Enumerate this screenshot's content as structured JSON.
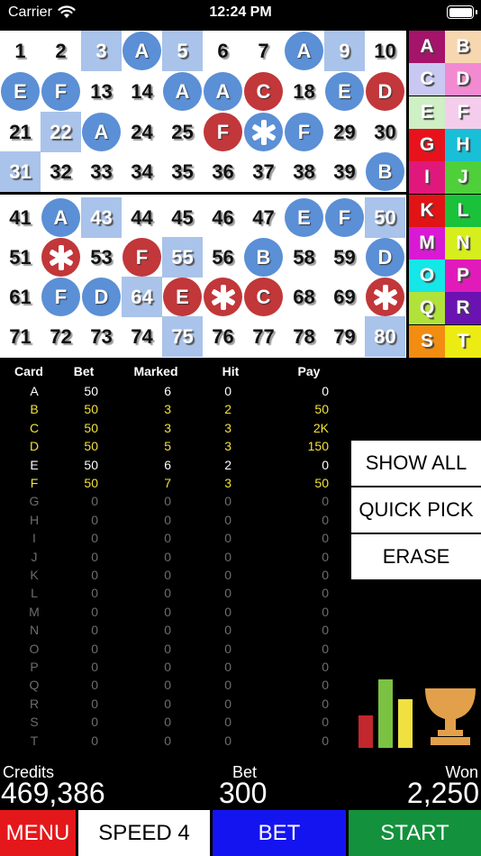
{
  "status_bar": {
    "carrier": "Carrier",
    "time": "12:24 PM"
  },
  "board": {
    "rows": [
      [
        {
          "n": "1"
        },
        {
          "n": "2"
        },
        {
          "n": "3",
          "sel": true
        },
        {
          "n": "4",
          "mark": "A",
          "color": "blue"
        },
        {
          "n": "5",
          "sel": true
        },
        {
          "n": "6"
        },
        {
          "n": "7"
        },
        {
          "n": "8",
          "mark": "A",
          "color": "blue"
        },
        {
          "n": "9",
          "sel": true
        },
        {
          "n": "10"
        }
      ],
      [
        {
          "n": "11",
          "mark": "E",
          "color": "blue"
        },
        {
          "n": "12",
          "mark": "F",
          "color": "blue"
        },
        {
          "n": "13"
        },
        {
          "n": "14"
        },
        {
          "n": "15",
          "mark": "A",
          "color": "blue"
        },
        {
          "n": "16",
          "mark": "A",
          "color": "blue"
        },
        {
          "n": "17",
          "mark": "C",
          "color": "red"
        },
        {
          "n": "18"
        },
        {
          "n": "19",
          "mark": "E",
          "color": "blue"
        },
        {
          "n": "20",
          "mark": "D",
          "color": "red"
        }
      ],
      [
        {
          "n": "21"
        },
        {
          "n": "22",
          "sel": true
        },
        {
          "n": "23",
          "mark": "A",
          "color": "blue"
        },
        {
          "n": "24"
        },
        {
          "n": "25"
        },
        {
          "n": "26",
          "mark": "F",
          "color": "red"
        },
        {
          "n": "27",
          "mark": "*",
          "color": "blue"
        },
        {
          "n": "28",
          "mark": "F",
          "color": "blue"
        },
        {
          "n": "29"
        },
        {
          "n": "30"
        }
      ],
      [
        {
          "n": "31",
          "sel": true
        },
        {
          "n": "32"
        },
        {
          "n": "33"
        },
        {
          "n": "34"
        },
        {
          "n": "35"
        },
        {
          "n": "36"
        },
        {
          "n": "37"
        },
        {
          "n": "38"
        },
        {
          "n": "39"
        },
        {
          "n": "40",
          "mark": "B",
          "color": "blue"
        }
      ],
      [
        {
          "n": "41"
        },
        {
          "n": "42",
          "mark": "A",
          "color": "blue"
        },
        {
          "n": "43",
          "sel": true
        },
        {
          "n": "44"
        },
        {
          "n": "45"
        },
        {
          "n": "46"
        },
        {
          "n": "47"
        },
        {
          "n": "48",
          "mark": "E",
          "color": "blue"
        },
        {
          "n": "49",
          "mark": "F",
          "color": "blue"
        },
        {
          "n": "50",
          "sel": true
        }
      ],
      [
        {
          "n": "51"
        },
        {
          "n": "52",
          "mark": "*",
          "color": "red"
        },
        {
          "n": "53"
        },
        {
          "n": "54",
          "mark": "F",
          "color": "red"
        },
        {
          "n": "55",
          "sel": true
        },
        {
          "n": "56"
        },
        {
          "n": "57",
          "mark": "B",
          "color": "blue"
        },
        {
          "n": "58"
        },
        {
          "n": "59"
        },
        {
          "n": "60",
          "mark": "D",
          "color": "blue"
        }
      ],
      [
        {
          "n": "61"
        },
        {
          "n": "62",
          "mark": "F",
          "color": "blue"
        },
        {
          "n": "63",
          "mark": "D",
          "color": "blue"
        },
        {
          "n": "64",
          "sel": true
        },
        {
          "n": "65",
          "mark": "E",
          "color": "red"
        },
        {
          "n": "66",
          "mark": "*",
          "color": "red"
        },
        {
          "n": "67",
          "mark": "C",
          "color": "red"
        },
        {
          "n": "68"
        },
        {
          "n": "69"
        },
        {
          "n": "70",
          "mark": "*",
          "color": "red"
        }
      ],
      [
        {
          "n": "71"
        },
        {
          "n": "72"
        },
        {
          "n": "73"
        },
        {
          "n": "74"
        },
        {
          "n": "75",
          "sel": true
        },
        {
          "n": "76"
        },
        {
          "n": "77"
        },
        {
          "n": "78"
        },
        {
          "n": "79"
        },
        {
          "n": "80",
          "sel": true
        }
      ]
    ]
  },
  "legend": [
    {
      "l": "A",
      "bg": "#a3146a"
    },
    {
      "l": "B",
      "bg": "#f7d7b0"
    },
    {
      "l": "C",
      "bg": "#c8c8f2"
    },
    {
      "l": "D",
      "bg": "#f28ad2"
    },
    {
      "l": "E",
      "bg": "#cef0c4"
    },
    {
      "l": "F",
      "bg": "#f5cdec"
    },
    {
      "l": "G",
      "bg": "#e8121c"
    },
    {
      "l": "H",
      "bg": "#18bfd6"
    },
    {
      "l": "I",
      "bg": "#e0187c"
    },
    {
      "l": "J",
      "bg": "#4fcf3a"
    },
    {
      "l": "K",
      "bg": "#e01414"
    },
    {
      "l": "L",
      "bg": "#19c23a"
    },
    {
      "l": "M",
      "bg": "#d81ad4"
    },
    {
      "l": "N",
      "bg": "#d6ee1c"
    },
    {
      "l": "O",
      "bg": "#15e6e8"
    },
    {
      "l": "P",
      "bg": "#e01bb9"
    },
    {
      "l": "Q",
      "bg": "#b1e23a"
    },
    {
      "l": "R",
      "bg": "#6a12b2"
    },
    {
      "l": "S",
      "bg": "#f28d12"
    },
    {
      "l": "T",
      "bg": "#ecec14"
    }
  ],
  "stats": {
    "headers": [
      "Card",
      "Bet",
      "Marked",
      "Hit",
      "Pay"
    ],
    "rows": [
      {
        "card": "A",
        "bet": "50",
        "marked": "6",
        "hit": "0",
        "pay": "0",
        "state": "white"
      },
      {
        "card": "B",
        "bet": "50",
        "marked": "3",
        "hit": "2",
        "pay": "50",
        "state": "yellow"
      },
      {
        "card": "C",
        "bet": "50",
        "marked": "3",
        "hit": "3",
        "pay": "2K",
        "state": "yellow"
      },
      {
        "card": "D",
        "bet": "50",
        "marked": "5",
        "hit": "3",
        "pay": "150",
        "state": "yellow"
      },
      {
        "card": "E",
        "bet": "50",
        "marked": "6",
        "hit": "2",
        "pay": "0",
        "state": "white"
      },
      {
        "card": "F",
        "bet": "50",
        "marked": "7",
        "hit": "3",
        "pay": "50",
        "state": "yellow"
      },
      {
        "card": "G",
        "bet": "0",
        "marked": "0",
        "hit": "0",
        "pay": "0",
        "state": "gray"
      },
      {
        "card": "H",
        "bet": "0",
        "marked": "0",
        "hit": "0",
        "pay": "0",
        "state": "gray"
      },
      {
        "card": "I",
        "bet": "0",
        "marked": "0",
        "hit": "0",
        "pay": "0",
        "state": "gray"
      },
      {
        "card": "J",
        "bet": "0",
        "marked": "0",
        "hit": "0",
        "pay": "0",
        "state": "gray"
      },
      {
        "card": "K",
        "bet": "0",
        "marked": "0",
        "hit": "0",
        "pay": "0",
        "state": "gray"
      },
      {
        "card": "L",
        "bet": "0",
        "marked": "0",
        "hit": "0",
        "pay": "0",
        "state": "gray"
      },
      {
        "card": "M",
        "bet": "0",
        "marked": "0",
        "hit": "0",
        "pay": "0",
        "state": "gray"
      },
      {
        "card": "N",
        "bet": "0",
        "marked": "0",
        "hit": "0",
        "pay": "0",
        "state": "gray"
      },
      {
        "card": "O",
        "bet": "0",
        "marked": "0",
        "hit": "0",
        "pay": "0",
        "state": "gray"
      },
      {
        "card": "P",
        "bet": "0",
        "marked": "0",
        "hit": "0",
        "pay": "0",
        "state": "gray"
      },
      {
        "card": "Q",
        "bet": "0",
        "marked": "0",
        "hit": "0",
        "pay": "0",
        "state": "gray"
      },
      {
        "card": "R",
        "bet": "0",
        "marked": "0",
        "hit": "0",
        "pay": "0",
        "state": "gray"
      },
      {
        "card": "S",
        "bet": "0",
        "marked": "0",
        "hit": "0",
        "pay": "0",
        "state": "gray"
      },
      {
        "card": "T",
        "bet": "0",
        "marked": "0",
        "hit": "0",
        "pay": "0",
        "state": "gray"
      }
    ]
  },
  "side_buttons": {
    "show_all": "SHOW ALL",
    "quick_pick": "QUICK PICK",
    "erase": "ERASE"
  },
  "totals": {
    "credits_label": "Credits",
    "credits_value": "469,386",
    "bet_label": "Bet",
    "bet_value": "300",
    "won_label": "Won",
    "won_value": "2,250"
  },
  "bottom_bar": {
    "menu": "MENU",
    "speed": "SPEED 4",
    "bet": "BET",
    "start": "START"
  },
  "icons": [
    "wifi-icon",
    "battery-icon",
    "star-icon",
    "bar-chart-icon",
    "trophy-icon"
  ],
  "colors": {
    "mark_blue": "#5b8fd6",
    "mark_red": "#c1373a",
    "selected_cell": "#a9c3ea",
    "stat_active": "#f2e23a",
    "stat_inactive": "#6d6d6d",
    "menu_bg": "#e4171b",
    "bet_bg": "#1414f0",
    "start_bg": "#13913c"
  }
}
